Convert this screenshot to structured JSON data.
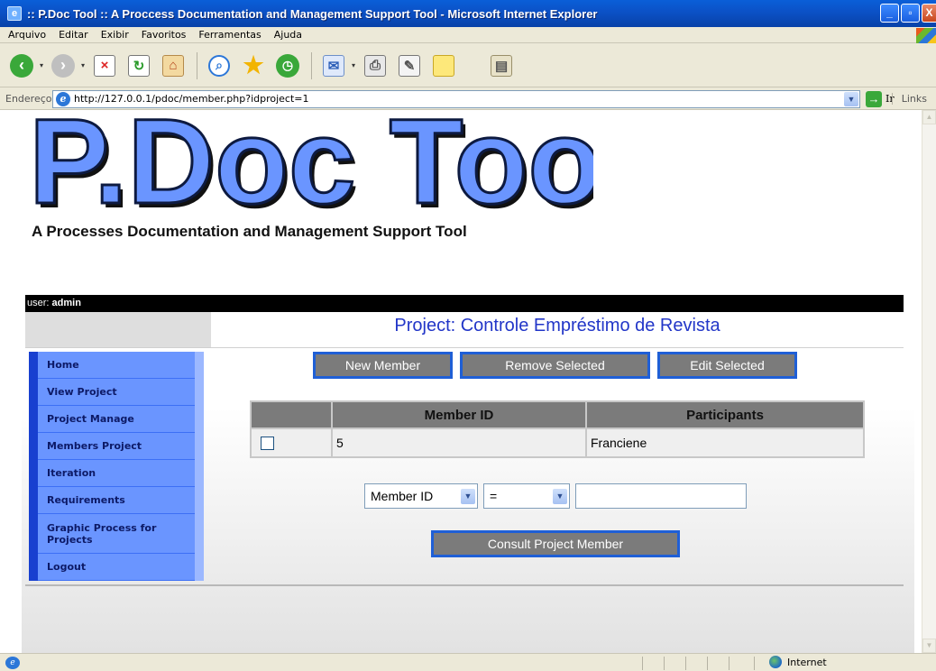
{
  "window": {
    "title": ":: P.Doc Tool :: A Proccess Documentation and Management Support Tool - Microsoft Internet Explorer",
    "buttons": {
      "minimize": "_",
      "maximize": "▫",
      "close": "X"
    }
  },
  "menu": [
    {
      "label": "Arquivo"
    },
    {
      "label": "Editar"
    },
    {
      "label": "Exibir"
    },
    {
      "label": "Favoritos"
    },
    {
      "label": "Ferramentas"
    },
    {
      "label": "Ajuda"
    }
  ],
  "toolbar": {
    "icons": [
      "back-icon",
      "forward-icon",
      "stop-icon",
      "refresh-icon",
      "home-icon",
      "search-icon",
      "favorites-icon",
      "history-icon",
      "mail-icon",
      "print-icon",
      "edit-icon",
      "messenger-icon",
      "research-icon"
    ]
  },
  "address": {
    "label": "Endereço",
    "url": "http://127.0.0.1/pdoc/member.php?idproject=1",
    "go_label": "Ir",
    "links_label": "Links"
  },
  "logo": {
    "main": "P.Doc Tool",
    "subtitle": "A Processes Documentation and Management Support Tool"
  },
  "user": {
    "label": "user:",
    "name": "admin"
  },
  "project": {
    "title": "Project: Controle Empréstimo de Revista"
  },
  "sidebar": {
    "items": [
      {
        "label": "Home"
      },
      {
        "label": "View Project"
      },
      {
        "label": "Project Manage"
      },
      {
        "label": "Members Project"
      },
      {
        "label": "Iteration"
      },
      {
        "label": "Requirements"
      },
      {
        "label": "Graphic Process for Projects"
      },
      {
        "label": "Logout"
      }
    ]
  },
  "actions": {
    "new_member": "New Member",
    "remove_selected": "Remove Selected",
    "edit_selected": "Edit Selected"
  },
  "table": {
    "headers": [
      "",
      "Member ID",
      "Participants"
    ],
    "rows": [
      {
        "checked": false,
        "member_id": "5",
        "participant": "Franciene"
      }
    ]
  },
  "filter": {
    "field": "Member ID",
    "operator": "=",
    "value": ""
  },
  "consult_button": "Consult Project Member",
  "status": {
    "zone": "Internet"
  },
  "colors": {
    "accent_blue": "#2236c8",
    "nav_blue": "#6a95ff",
    "button_gray": "#7b7b7b",
    "button_border": "#1f5fd6"
  }
}
